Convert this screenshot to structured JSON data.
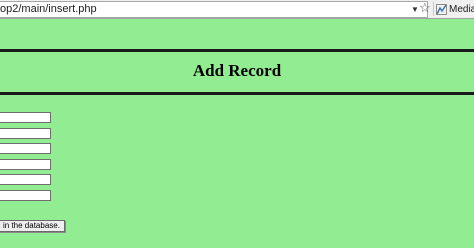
{
  "browser": {
    "url": "op2/main/insert.php",
    "media_label": "Media"
  },
  "page": {
    "title": "Add Record",
    "form": {
      "fields": [
        {
          "value": ""
        },
        {
          "value": ""
        },
        {
          "value": ""
        },
        {
          "value": ""
        },
        {
          "value": ""
        },
        {
          "value": ""
        }
      ],
      "submit_label": "in the database."
    }
  },
  "colors": {
    "page_background": "#92ed92",
    "rule": "#1a1a1a"
  }
}
